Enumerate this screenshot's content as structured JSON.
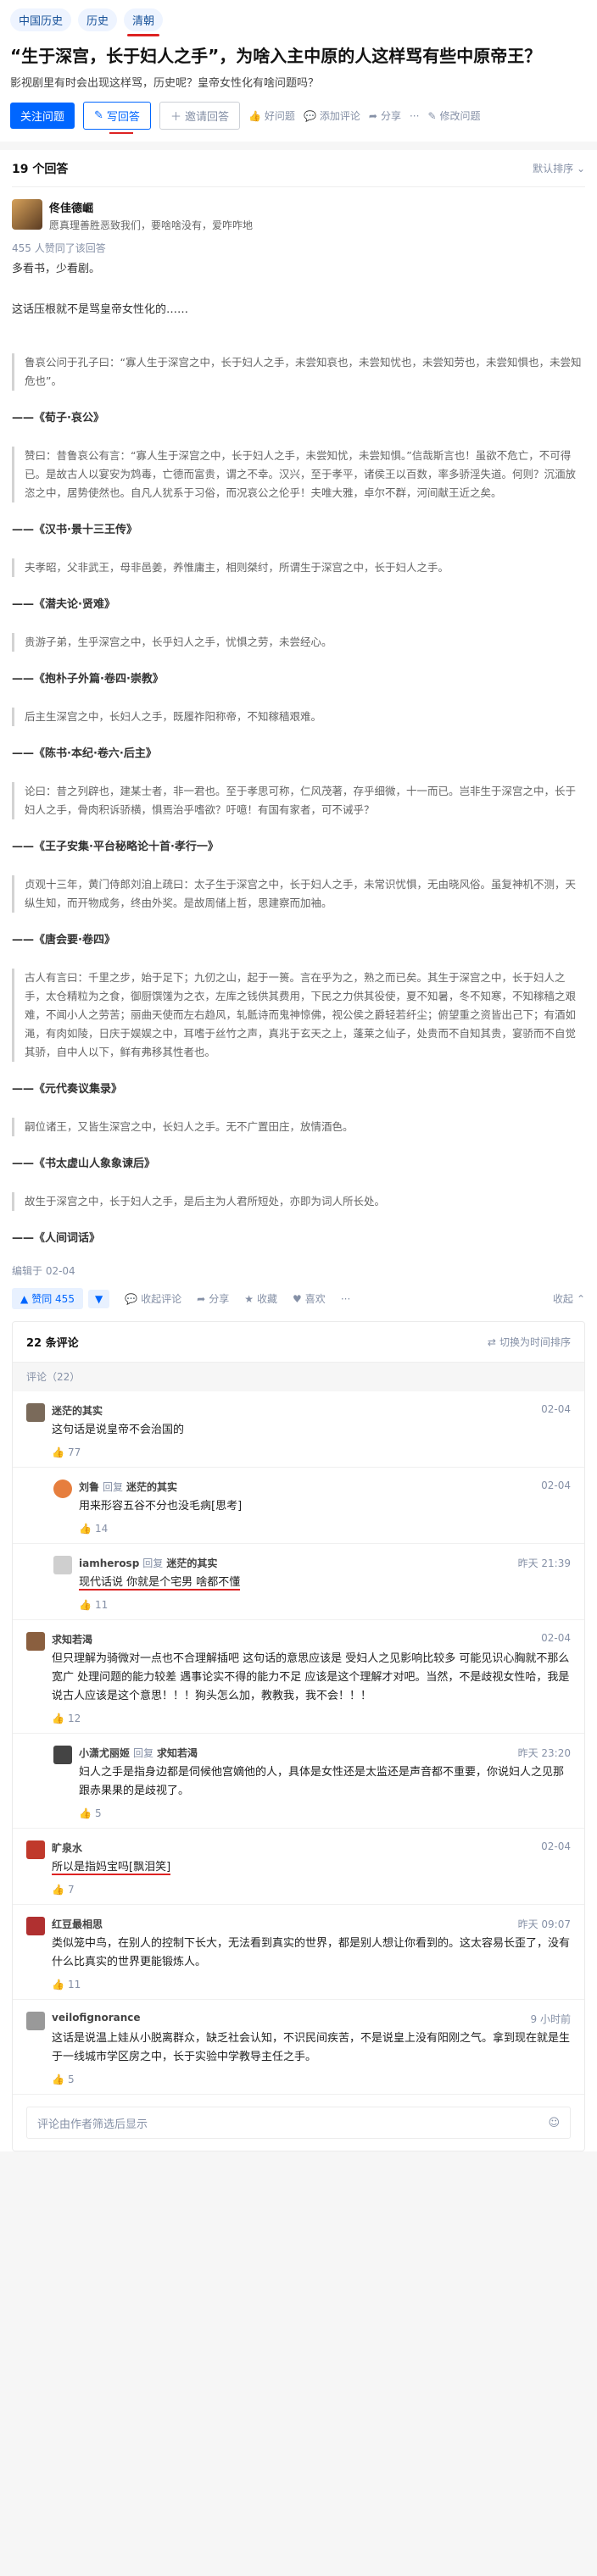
{
  "topics": [
    "中国历史",
    "历史",
    "清朝"
  ],
  "question": {
    "title": "“生于深宫，长于妇人之手”，为啥入主中原的人这样骂有些中原帝王？",
    "detail": "影视剧里有时会出现这样骂，历史呢？皇帝女性化有啥问题吗？"
  },
  "actions": {
    "follow": "关注问题",
    "write": "写回答",
    "invite": "邀请回答",
    "good_question": "好问题",
    "add_comment": "添加评论",
    "share": "分享",
    "more": "···",
    "modify": "修改问题"
  },
  "answers_header": {
    "count": "19 个回答",
    "sort": "默认排序"
  },
  "author": {
    "name": "佟佳德崛",
    "bio": "愿真理善胜恶致我们，要啥啥没有，爱咋咋地",
    "agree": "455 人赞同了该回答"
  },
  "content": {
    "intro1": "多看书，少看剧。",
    "intro2": "这话压根就不是骂皇帝女性化的……",
    "quotes": [
      {
        "text": "鲁哀公问于孔子曰：“寡人生于深宫之中，长于妇人之手，未尝知哀也，未尝知忧也，未尝知劳也，未尝知惧也，未尝知危也”。",
        "source": "——《荀子·哀公》"
      },
      {
        "text": "赞曰：昔鲁哀公有言：“寡人生于深宫之中，长于妇人之手，未尝知忧，未尝知惧。”信哉斯言也！虽欲不危亡，不可得已。是故古人以宴安为鸩毒，亡德而富贵，谓之不幸。汉兴，至于孝平，诸侯王以百数，率多骄淫失道。何则？沉湎放恣之中，居势使然也。自凡人犹系于习俗，而况哀公之伦乎！夫唯大雅，卓尔不群，河间献王近之矣。",
        "source": "——《汉书·景十三王传》"
      },
      {
        "text": "夫孝昭，父非武王，母非邑姜，养惟庸主，相则桀纣，所谓生于深宫之中，长于妇人之手。",
        "source": "——《潜夫论·贤难》"
      },
      {
        "text": "贵游子弟，生乎深宫之中，长乎妇人之手，忧惧之劳，未尝经心。",
        "source": "——《抱朴子外篇·卷四·崇教》"
      },
      {
        "text": "后主生深宫之中，长妇人之手，既履祚阳称帝，不知稼穑艰难。",
        "source": "——《陈书·本纪·卷六·后主》"
      },
      {
        "text": "论曰：昔之列辟也，建某士者，非一君也。至于孝思可称，仁风茂著，存乎细微，十一而已。岂非生于深宫之中，长于妇人之手，骨肉积诉骄横，惧焉治乎嗜欲？吁噫！有国有家者，可不诫乎？",
        "source": "——《王子安集·平台秘略论十首·孝行一》"
      },
      {
        "text": "贞观十三年，黄门侍郎刘洎上疏曰：太子生于深宫之中，长于妇人之手，未常识忧惧，无由晓风俗。虽复神机不测，天纵生知，而开物成务，终由外奖。是故周储上哲，思建察而加袖。",
        "source": "——《唐会要·卷四》"
      },
      {
        "text": "古人有言曰：千里之步，始于足下；九仞之山，起于一篑。言在乎为之，熟之而已矣。其生于深宫之中，长于妇人之手，太仓精粒为之食，御厨馔馐为之衣，左库之钱供其费用，下民之力供其役使，夏不知暑，冬不知寒，不知稼穑之艰难，不闻小人之劳苦；丽曲天使而左右趋风，轧骶诗而鬼神惊佛，视公侯之爵轻若纤尘；俯望重之资皆出己下；有酒如渑，有肉如陵，日庆于娱娱之中，耳嗜于丝竹之声，真兆于玄天之上，蓬莱之仙子，处贵而不自知其贵，宴骄而不自觉其骄，自中人以下，鲜有弗移其性者也。",
        "source": "——《元代奏议集录》"
      },
      {
        "text": "嗣位诸王，又皆生深宫之中，长妇人之手。无不广置田庄，放情酒色。",
        "source": "——《书太虚山人象象谏后》"
      },
      {
        "text": "故生于深宫之中，长于妇人之手，是后主为人君所短处，亦即为词人所长处。",
        "source": "——《人间词话》"
      }
    ],
    "edited": "编辑于 02-04"
  },
  "answer_actions": {
    "vote": "赞同 455",
    "collect": "收起评论",
    "share": "分享",
    "favorite": "收藏",
    "like": "喜欢",
    "fold": "收起"
  },
  "comments": {
    "title": "22 条评论",
    "switch": "切换为时间排序",
    "sub": "评论（22）",
    "items": [
      {
        "user": "迷茫的其实",
        "time": "02-04",
        "text": "这句话是说皇帝不会治国的",
        "likes": "77",
        "avatar": "#7a6a5a"
      },
      {
        "user": "刘鲁",
        "rel": "回复",
        "to": "迷茫的其实",
        "time": "02-04",
        "text": "用来形容五谷不分也没毛病[思考]",
        "likes": "14",
        "avatar": "#e67e3e"
      },
      {
        "user": "iamherosp",
        "rel": "回复",
        "to": "迷茫的其实",
        "time": "昨天 21:39",
        "text": "现代话说 你就是个宅男 啥都不懂",
        "likes": "11",
        "avatar": "#cfcfcf"
      },
      {
        "user": "求知若渴",
        "time": "02-04",
        "text": "但只理解为骑微对一点也不合理解插吧 这句话的意思应该是 受妇人之见影响比较多 可能见识心胸就不那么宽广 处理问题的能力较差 遇事论实不得的能力不足 应该是这个理解才对吧。当然，不是歧视女性哈，我是说古人应该是这个意思！！！狗头怎么加，教教我，我不会！！！",
        "likes": "12",
        "avatar": "#8a5f3f"
      },
      {
        "user": "小潇尤丽姬",
        "rel": "回复",
        "to": "求知若渴",
        "time": "昨天 23:20",
        "text": "妇人之手是指身边都是伺候他宫嫡他的人，具体是女性还是太监还是声音都不重要，你说妇人之见那跟赤果果的是歧视了。",
        "likes": "5",
        "avatar": "#444444"
      },
      {
        "user": "旷泉水",
        "time": "02-04",
        "text": "所以是指妈宝吗[飘泪笑]",
        "likes": "7",
        "avatar": "#c0392b"
      },
      {
        "user": "红豆最相思",
        "time": "昨天 09:07",
        "text": "类似笼中鸟，在别人的控制下长大，无法看到真实的世界，都是别人想让你看到的。这太容易长歪了，没有什么比真实的世界更能锻炼人。",
        "likes": "11",
        "avatar": "#b03030"
      },
      {
        "user": "veilofignorance",
        "time": "9 小时前",
        "text": "这话是说温上娃从小脱离群众，缺乏社会认知，不识民间疾苦，不是说皇上没有阳刚之气。拿到现在就是生于一线城市学区房之中，长于实验中学教导主任之手。",
        "likes": "5",
        "avatar": "#999999"
      }
    ],
    "input_placeholder": "评论由作者筛选后显示"
  }
}
